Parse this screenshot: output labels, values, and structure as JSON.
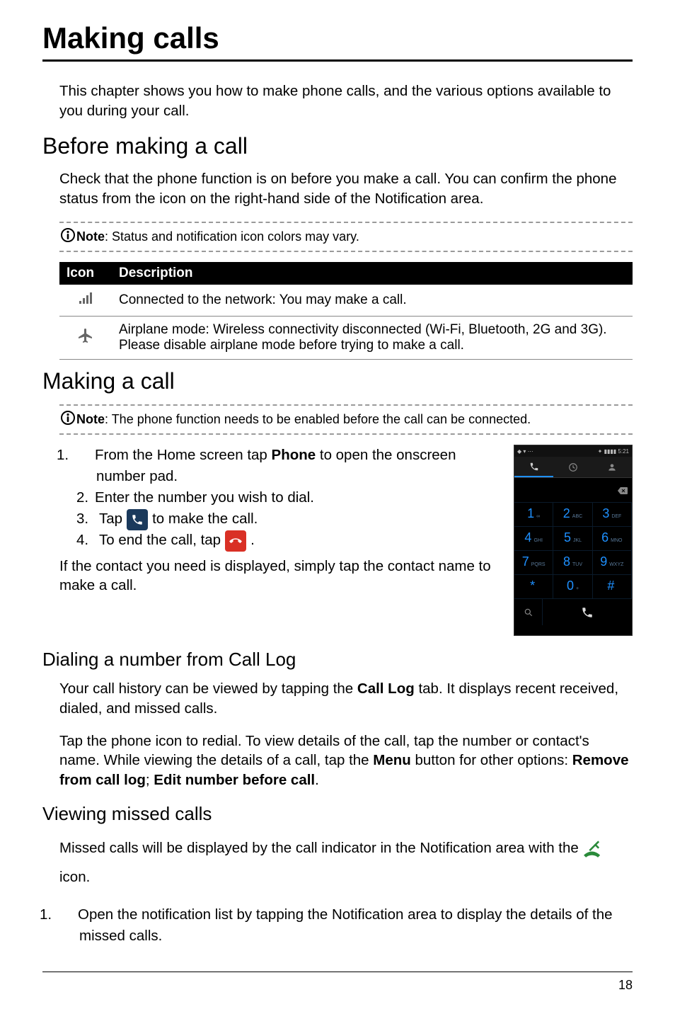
{
  "title": "Making calls",
  "intro": "This chapter shows you how to make phone calls, and the various options available to you during your call.",
  "sections": {
    "before": {
      "heading": "Before making a call",
      "text": "Check that the phone function is on before you make a call. You can confirm the phone status from the icon on the right-hand side of the Notification area.",
      "note_label": "Note",
      "note_text": "Status and notification icon colors may vary.",
      "table": {
        "headers": {
          "icon": "Icon",
          "description": "Description"
        },
        "rows": [
          {
            "icon": "signal-icon",
            "desc": "Connected to the network: You may make a call."
          },
          {
            "icon": "airplane-icon",
            "desc": "Airplane mode: Wireless connectivity disconnected (Wi-Fi, Bluetooth, 2G and 3G). Please disable airplane mode before trying to make a call."
          }
        ]
      }
    },
    "making": {
      "heading": "Making a call",
      "note_label": "Note",
      "note_text": "The phone function needs to be enabled before the call can be connected.",
      "steps": {
        "s1a": "From the Home screen tap ",
        "s1b": "Phone",
        "s1c": " to open the onscreen number pad.",
        "s2": "Enter the number you wish to dial.",
        "s3a": "Tap ",
        "s3b": " to make the call.",
        "s4a": "To end the call, tap ",
        "s4b": "."
      },
      "after": "If the contact you need is displayed, simply tap the contact name to make a call."
    },
    "calllog": {
      "heading": "Dialing a number from Call Log",
      "p1a": "Your call history can be viewed by tapping the ",
      "p1b": "Call Log",
      "p1c": " tab. It displays recent received, dialed, and missed calls.",
      "p2a": "Tap the phone icon to redial. To view details of the call, tap the number or contact's name. While viewing the details of a call, tap the ",
      "p2b": "Menu",
      "p2c": " button for other options: ",
      "p2d": "Remove from call log",
      "p2e": "; ",
      "p2f": "Edit number before call",
      "p2g": "."
    },
    "missed": {
      "heading": "Viewing missed calls",
      "p1a": "Missed calls will be displayed by the call indicator in the Notification area with the ",
      "p1b": " icon.",
      "s1": "Open the notification list by tapping the Notification area to display the details of the missed calls."
    }
  },
  "dialer": {
    "time": "5:21",
    "keys": [
      {
        "d": "1",
        "l": "∞"
      },
      {
        "d": "2",
        "l": "ABC"
      },
      {
        "d": "3",
        "l": "DEF"
      },
      {
        "d": "4",
        "l": "GHI"
      },
      {
        "d": "5",
        "l": "JKL"
      },
      {
        "d": "6",
        "l": "MNO"
      },
      {
        "d": "7",
        "l": "PQRS"
      },
      {
        "d": "8",
        "l": "TUV"
      },
      {
        "d": "9",
        "l": "WXYZ"
      },
      {
        "d": "*",
        "l": ""
      },
      {
        "d": "0",
        "l": "+"
      },
      {
        "d": "#",
        "l": ""
      }
    ]
  },
  "page_number": "18"
}
